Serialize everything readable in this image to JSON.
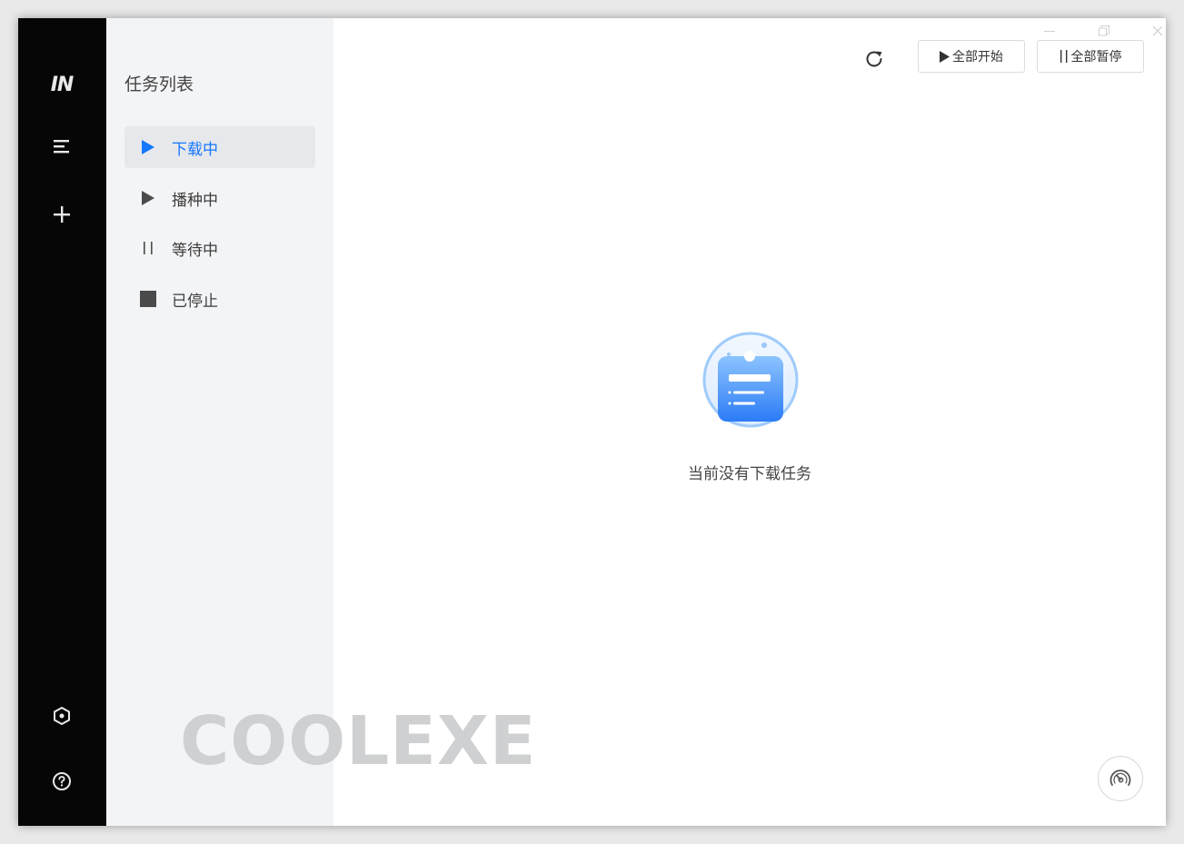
{
  "rail": {
    "logo": "IN",
    "icons": [
      "menu-icon",
      "plus-icon",
      "settings-hex-icon",
      "help-circle-icon"
    ]
  },
  "sidebar": {
    "title": "任务列表",
    "items": [
      {
        "label": "下载中",
        "icon": "play-icon",
        "active": true
      },
      {
        "label": "播种中",
        "icon": "play-icon",
        "active": false
      },
      {
        "label": "等待中",
        "icon": "pause-icon",
        "active": false
      },
      {
        "label": "已停止",
        "icon": "stop-icon",
        "active": false
      }
    ]
  },
  "toolbar": {
    "start_all": "全部开始",
    "pause_all": "全部暂停"
  },
  "empty_state": {
    "message": "当前没有下载任务"
  },
  "watermark": "COOLEXE",
  "colors": {
    "accent": "#1677ff",
    "rail_bg": "#060606",
    "sidebar_bg": "#f3f4f6",
    "active_item_bg": "#e6e8eb"
  }
}
